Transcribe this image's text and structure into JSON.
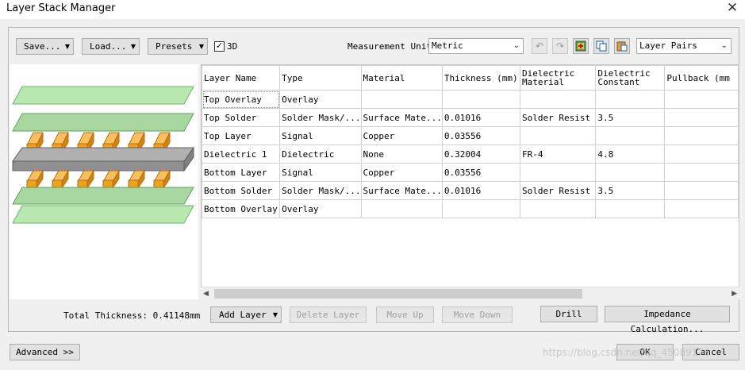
{
  "window": {
    "title": "Layer Stack Manager",
    "close_glyph": "✕"
  },
  "toolbar": {
    "save_label": "Save...",
    "load_label": "Load...",
    "presets_label": "Presets",
    "three_d_label": "3D",
    "three_d_checked": true,
    "measurement_unit_label": "Measurement Unit",
    "measurement_unit_value": "Metric",
    "layer_pairs_value": "Layer Pairs",
    "icons": [
      "undo-icon",
      "redo-icon",
      "add-layer-icon",
      "copy-icon",
      "paste-icon"
    ]
  },
  "table": {
    "columns": [
      "Layer Name",
      "Type",
      "Material",
      "Thickness (mm)",
      "Dielectric Material",
      "Dielectric Constant",
      "Pullback (mm"
    ],
    "rows": [
      [
        "Top Overlay",
        "Overlay",
        "",
        "",
        "",
        "",
        ""
      ],
      [
        "Top Solder",
        "Solder Mask/...",
        "Surface Mate...",
        "0.01016",
        "Solder Resist",
        "3.5",
        ""
      ],
      [
        "Top Layer",
        "Signal",
        "Copper",
        "0.03556",
        "",
        "",
        ""
      ],
      [
        "Dielectric 1",
        "Dielectric",
        "None",
        "0.32004",
        "FR-4",
        "4.8",
        ""
      ],
      [
        "Bottom Layer",
        "Signal",
        "Copper",
        "0.03556",
        "",
        "",
        ""
      ],
      [
        "Bottom Solder",
        "Solder Mask/...",
        "Surface Mate...",
        "0.01016",
        "Solder Resist",
        "3.5",
        ""
      ],
      [
        "Bottom Overlay",
        "Overlay",
        "",
        "",
        "",
        "",
        ""
      ]
    ]
  },
  "footer": {
    "total_thickness": "Total Thickness: 0.41148mm",
    "add_layer_label": "Add Layer",
    "delete_layer_label": "Delete Layer",
    "move_up_label": "Move Up",
    "move_down_label": "Move Down",
    "drill_label": "Drill",
    "impedance_label": "Impedance Calculation...",
    "advanced_label": "Advanced >>",
    "ok_label": "OK",
    "cancel_label": "Cancel"
  },
  "watermark": "https://blog.csdn.net/qq_45089176",
  "colors": {
    "overlay_green": "#b8e8b0",
    "solder_green": "#a8d8a0",
    "copper_orange": "#f0a020",
    "dielectric_gray": "#909090"
  }
}
